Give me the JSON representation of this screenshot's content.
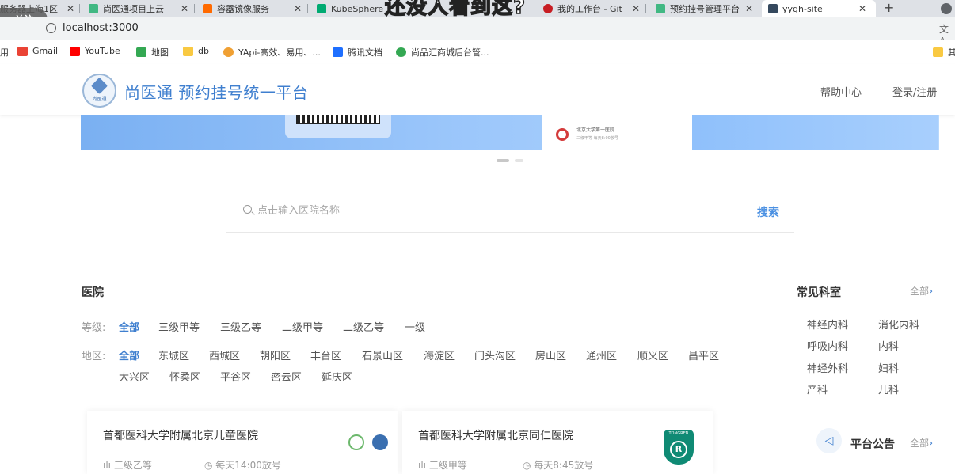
{
  "browser": {
    "tabs": [
      {
        "label": "服务器上海1区",
        "icon_color": "#5f6368"
      },
      {
        "label": "尚医通项目上云",
        "icon_color": "#41b883"
      },
      {
        "label": "容器镜像服务",
        "icon_color": "#ff6a00"
      },
      {
        "label": "KubeSphere",
        "icon_color": "#00aa72"
      },
      {
        "label": "我的工作台 - Git",
        "icon_color": "#c71d23"
      },
      {
        "label": "预约挂号管理平台",
        "icon_color": "#41b883"
      },
      {
        "label": "yygh-site",
        "icon_color": "#35495e"
      }
    ],
    "new_tab_label": "+",
    "overlay_caption": "还没人看到这?",
    "follow_label": "+ 关注",
    "address": "localhost:3000",
    "info_icon_label": "i",
    "translate_icon_label": "文A"
  },
  "bookmarks": [
    {
      "label": "用",
      "icon_color": ""
    },
    {
      "label": "Gmail",
      "icon_color": "#ea4335"
    },
    {
      "label": "YouTube",
      "icon_color": "#ff0000"
    },
    {
      "label": "地图",
      "icon_color": "#34a853"
    },
    {
      "label": "db",
      "icon_color": "#f9c942"
    },
    {
      "label": "YApi-高效、易用、...",
      "icon_color": "#f0a033"
    },
    {
      "label": "腾讯文档",
      "icon_color": "#1e6fff"
    },
    {
      "label": "尚品汇商城后台管...",
      "icon_color": "#34a853"
    },
    {
      "label": "其",
      "icon_color": "#f9c942"
    }
  ],
  "header": {
    "logo_text": "尚医通",
    "title": "尚医通 预约挂号统一平台",
    "help": "帮助中心",
    "login": "登录/注册"
  },
  "banner": {
    "card_line1": "北京大学第一医院",
    "card_line2": "三级甲等 每天8:00放号"
  },
  "search": {
    "placeholder": "点击输入医院名称",
    "button": "搜索"
  },
  "hospitals": {
    "title": "医院",
    "level_label": "等级:",
    "levels": [
      "全部",
      "三级甲等",
      "三级乙等",
      "二级甲等",
      "二级乙等",
      "一级"
    ],
    "region_label": "地区:",
    "regions": [
      "全部",
      "东城区",
      "西城区",
      "朝阳区",
      "丰台区",
      "石景山区",
      "海淀区",
      "门头沟区",
      "房山区",
      "通州区",
      "顺义区",
      "昌平区",
      "大兴区",
      "怀柔区",
      "平谷区",
      "密云区",
      "延庆区"
    ],
    "cards": [
      {
        "name": "首都医科大学附属北京儿童医院",
        "level": "三级乙等",
        "release": "每天14:00放号"
      },
      {
        "name": "首都医科大学附属北京同仁医院",
        "level": "三级甲等",
        "release": "每天8:45放号",
        "logo_text": "TONGREN",
        "logo_mark": "R"
      }
    ]
  },
  "departments": {
    "title": "常见科室",
    "all": "全部",
    "items": [
      "神经内科",
      "消化内科",
      "呼吸内科",
      "内科",
      "神经外科",
      "妇科",
      "产科",
      "儿科"
    ]
  },
  "notice": {
    "title": "平台公告",
    "all": "全部"
  },
  "colors": {
    "accent": "#3f7fcf",
    "search_button": "#4a90e2"
  }
}
